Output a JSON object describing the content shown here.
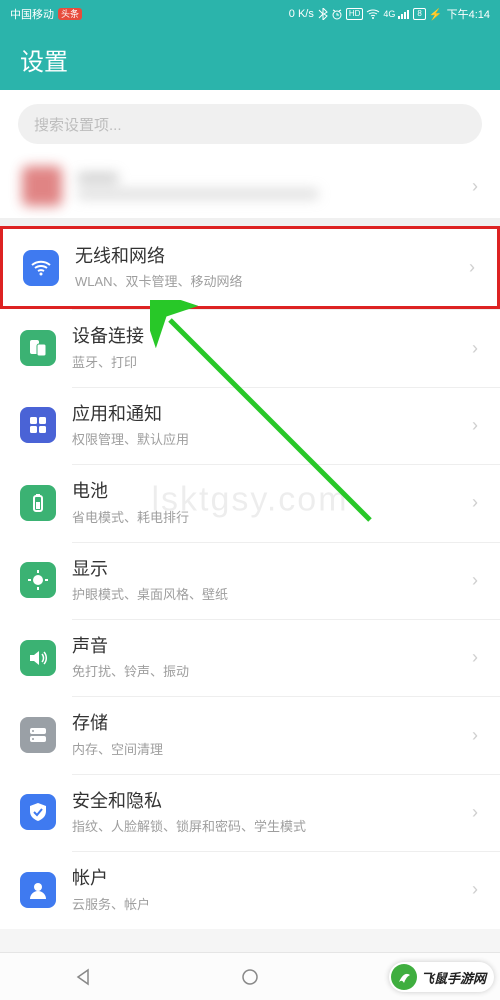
{
  "status": {
    "carrier": "中国移动",
    "badge": "头条",
    "speed": "0 K/s",
    "hd": "HD",
    "net": "4G",
    "battery": "8",
    "time": "下午4:14"
  },
  "header": {
    "title": "设置"
  },
  "search": {
    "placeholder": "搜索设置项..."
  },
  "items": [
    {
      "id": "wireless",
      "title": "无线和网络",
      "sub": "WLAN、双卡管理、移动网络",
      "color": "#3f7af0",
      "highlight": true
    },
    {
      "id": "device-conn",
      "title": "设备连接",
      "sub": "蓝牙、打印",
      "color": "#3bb273"
    },
    {
      "id": "apps-notif",
      "title": "应用和通知",
      "sub": "权限管理、默认应用",
      "color": "#4a63d6"
    },
    {
      "id": "battery",
      "title": "电池",
      "sub": "省电模式、耗电排行",
      "color": "#3bb273"
    },
    {
      "id": "display",
      "title": "显示",
      "sub": "护眼模式、桌面风格、壁纸",
      "color": "#3bb273"
    },
    {
      "id": "sound",
      "title": "声音",
      "sub": "免打扰、铃声、振动",
      "color": "#3bb273"
    },
    {
      "id": "storage",
      "title": "存储",
      "sub": "内存、空间清理",
      "color": "#9aa0a6"
    },
    {
      "id": "security",
      "title": "安全和隐私",
      "sub": "指纹、人脸解锁、锁屏和密码、学生模式",
      "color": "#3f7af0"
    },
    {
      "id": "accounts",
      "title": "帐户",
      "sub": "云服务、帐户",
      "color": "#3f7af0"
    }
  ],
  "watermark": {
    "text": "飞鼠手游网",
    "site": "lsktgsy.com"
  }
}
